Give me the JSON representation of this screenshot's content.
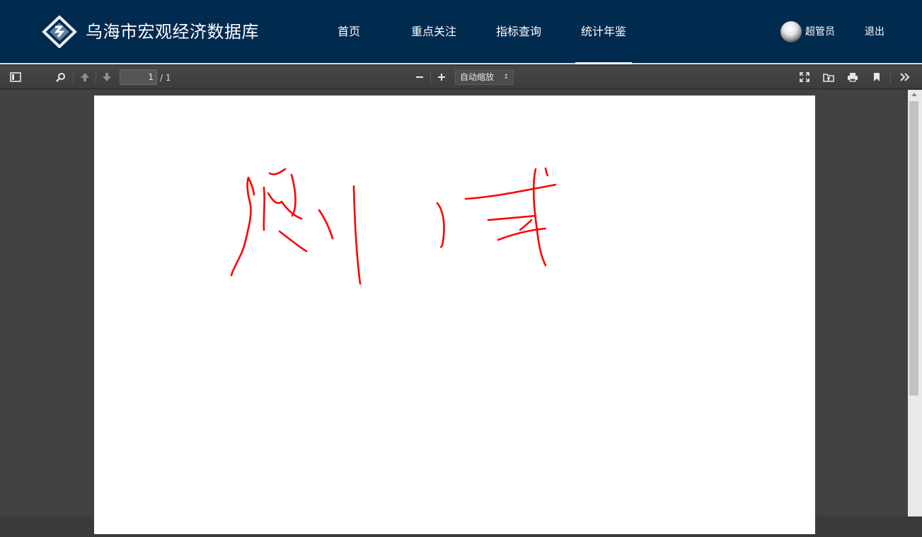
{
  "header": {
    "title": "乌海市宏观经济数据库",
    "nav": [
      {
        "label": "首页"
      },
      {
        "label": "重点关注"
      },
      {
        "label": "指标查询"
      },
      {
        "label": "统计年鉴"
      }
    ],
    "active_nav": "统计年鉴",
    "user": "超管员",
    "logout": "退出"
  },
  "toolbar": {
    "current_page": "1",
    "page_total": "/ 1",
    "zoom": "自动缩放",
    "icons": [
      "sidebar-toggle-icon",
      "search-icon",
      "previous-page-icon",
      "next-page-icon",
      "zoom-out-icon",
      "zoom-in-icon",
      "presentation-mode-icon",
      "open-file-icon",
      "print-icon",
      "bookmark-icon",
      "tools-icon"
    ]
  },
  "document": {
    "content": "handwritten red strokes",
    "stroke_color": "#ff0000"
  },
  "colors": {
    "header_bg": "#012a4f",
    "toolbar_bg": "#474747",
    "viewer_bg": "#414141"
  }
}
